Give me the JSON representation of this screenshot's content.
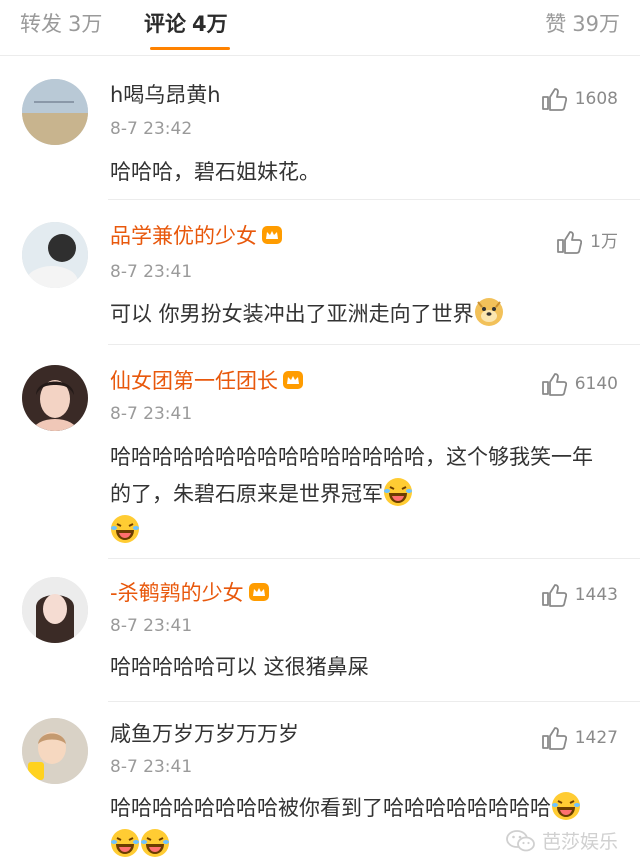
{
  "tabs": {
    "repost": {
      "label": "转发",
      "count": "3万"
    },
    "comment": {
      "label": "评论",
      "count": "4万"
    },
    "like": {
      "label": "赞",
      "count": "39万"
    }
  },
  "comments": [
    {
      "username": "h喝乌昂黄h",
      "time": "8-7 23:42",
      "likes": "1608",
      "text": "哈哈哈，碧石姐妹花。"
    },
    {
      "username": "品学兼优的少女",
      "time": "8-7 23:41",
      "likes": "1万",
      "text": "可以 你男扮女装冲出了亚洲走向了世界"
    },
    {
      "username": "仙女团第一任团长",
      "time": "8-7 23:41",
      "likes": "6140",
      "text": "哈哈哈哈哈哈哈哈哈哈哈哈哈哈哈，这个够我笑一年的了，朱碧石原来是世界冠军"
    },
    {
      "username": "-杀鹌鹑的少女",
      "time": "8-7 23:41",
      "likes": "1443",
      "text": "哈哈哈哈哈可以 这很猪鼻屎"
    },
    {
      "username": "咸鱼万岁万岁万万岁",
      "time": "8-7 23:41",
      "likes": "1427",
      "text": "哈哈哈哈哈哈哈哈被你看到了哈哈哈哈哈哈哈哈"
    }
  ],
  "watermark": "芭莎娱乐",
  "colors": {
    "accent": "#ff8200",
    "vip_name": "#e8580c",
    "text": "#333333",
    "muted": "#9a9a9a"
  },
  "icons": [
    "thumbs-up-icon",
    "crown-icon",
    "doge-emoji-icon",
    "laughing-tears-emoji-icon",
    "wechat-icon"
  ]
}
